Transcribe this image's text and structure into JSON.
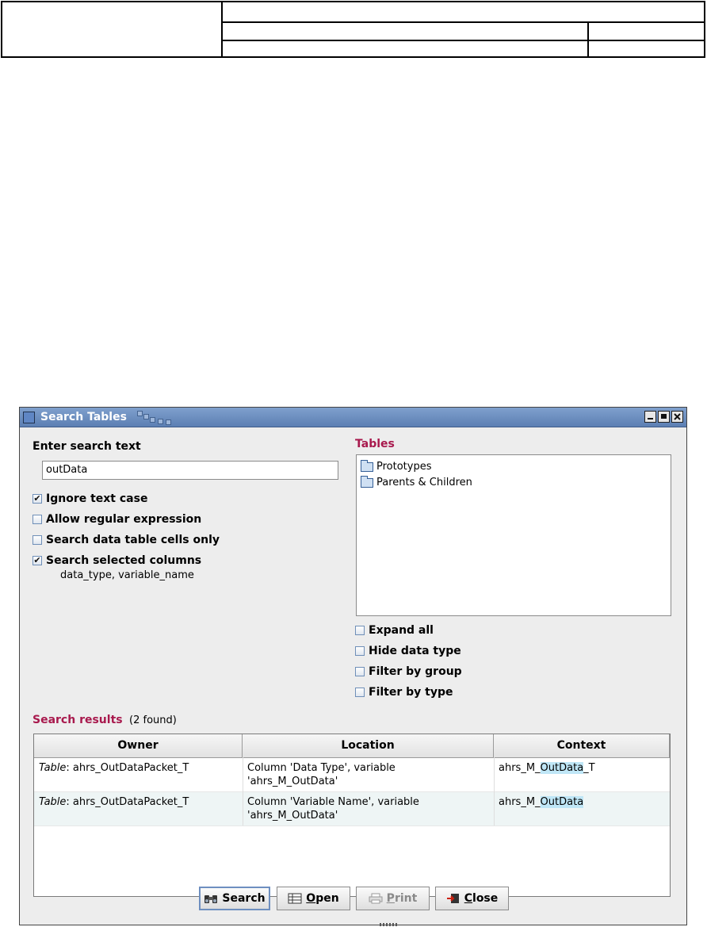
{
  "window": {
    "title": "Search Tables"
  },
  "search": {
    "label": "Enter search text",
    "value": "outData"
  },
  "options": [
    {
      "label": "Ignore text case",
      "checked": true
    },
    {
      "label": "Allow regular expression",
      "checked": false
    },
    {
      "label": "Search data table cells only",
      "checked": false
    },
    {
      "label": "Search selected columns",
      "checked": true
    }
  ],
  "selected_columns": "data_type, variable_name",
  "tables": {
    "label": "Tables",
    "items": [
      "Prototypes",
      "Parents & Children"
    ]
  },
  "table_options": [
    {
      "label": "Expand all",
      "checked": false
    },
    {
      "label": "Hide data type",
      "checked": false
    },
    {
      "label": "Filter by group",
      "checked": false
    },
    {
      "label": "Filter by type",
      "checked": false
    }
  ],
  "results": {
    "label": "Search results",
    "count": "(2 found)",
    "columns": [
      "Owner",
      "Location",
      "Context"
    ],
    "rows": [
      {
        "owner_kind": "Table",
        "owner_name": ": ahrs_OutDataPacket_T",
        "location_1": "Column 'Data Type', variable",
        "location_2": "'ahrs_M_OutData'",
        "context_pre": "ahrs_M_",
        "context_hl": "OutData",
        "context_post": "_T"
      },
      {
        "owner_kind": "Table",
        "owner_name": ": ahrs_OutDataPacket_T",
        "location_1": "Column 'Variable Name', variable",
        "location_2": "'ahrs_M_OutData'",
        "context_pre": "ahrs_M_",
        "context_hl": "OutData",
        "context_post": ""
      }
    ]
  },
  "buttons": {
    "search": "Search",
    "open_mnemonic": "O",
    "open_rest": "pen",
    "print_mnemonic": "P",
    "print_rest": "rint",
    "close_mnemonic": "C",
    "close_rest": "lose"
  }
}
